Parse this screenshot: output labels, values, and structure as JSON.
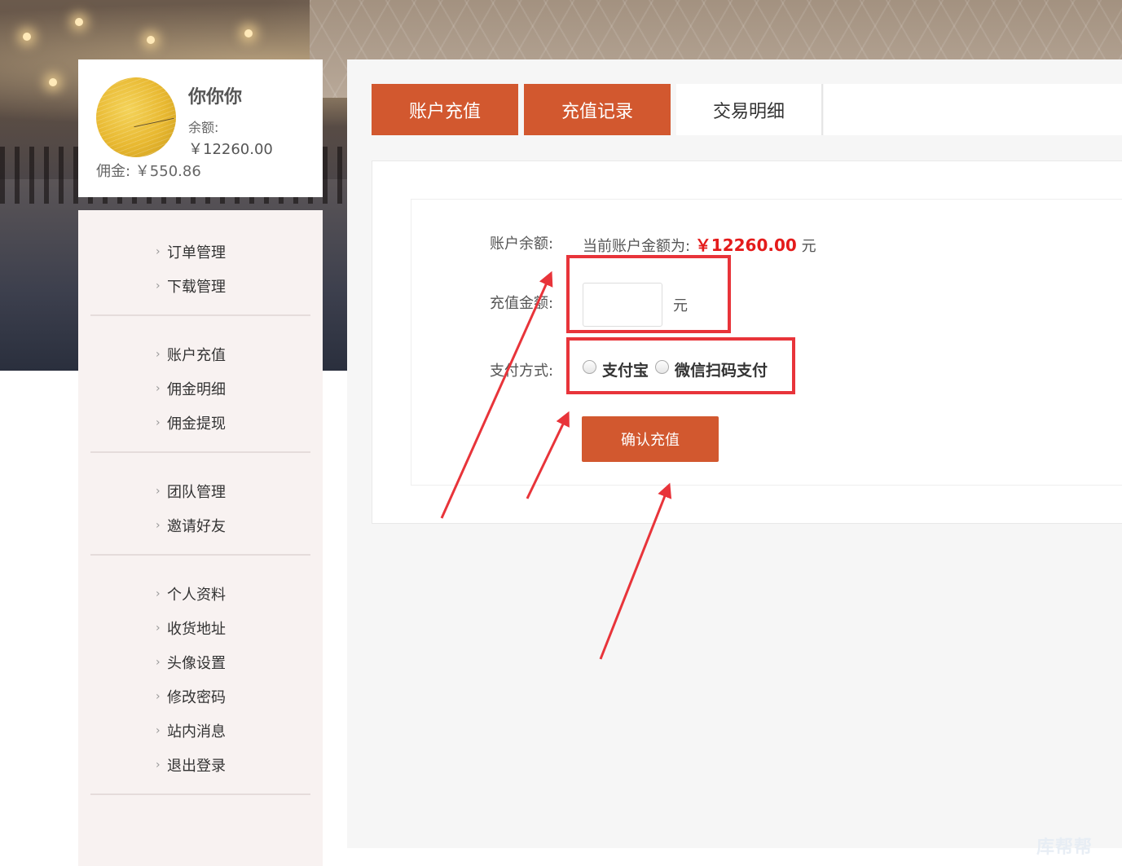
{
  "profile": {
    "username": "你你你",
    "balance_label": "余额:",
    "balance_value": "￥12260.00",
    "commission": "佣金: ￥550.86"
  },
  "sidebar": {
    "groups": [
      [
        "订单管理",
        "下载管理"
      ],
      [
        "账户充值",
        "佣金明细",
        "佣金提现"
      ],
      [
        "团队管理",
        "邀请好友"
      ],
      [
        "个人资料",
        "收货地址",
        "头像设置",
        "修改密码",
        "站内消息",
        "退出登录"
      ]
    ]
  },
  "tabs": [
    {
      "label": "账户充值",
      "active": true
    },
    {
      "label": "充值记录",
      "active": true
    },
    {
      "label": "交易明细",
      "active": false
    }
  ],
  "form": {
    "balance_label": "账户余额:",
    "balance_prefix": "当前账户金额为:",
    "balance_amount": "￥12260.00",
    "balance_unit": "元",
    "amount_label": "充值金额:",
    "amount_value": "",
    "amount_unit": "元",
    "method_label": "支付方式:",
    "methods": [
      "支付宝",
      "微信扫码支付"
    ],
    "confirm_label": "确认充值"
  },
  "colors": {
    "accent": "#d2582f",
    "price": "#e41b1b",
    "annotation": "#e8343a"
  },
  "watermark": "库帮帮"
}
